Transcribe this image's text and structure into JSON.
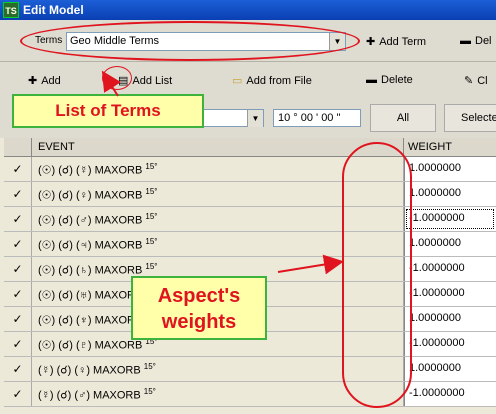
{
  "window": {
    "title": "Edit Model",
    "logo": "TS"
  },
  "toolbar1": {
    "terms_label": "Terms",
    "terms_value": "Geo Middle Terms",
    "add_term_label": "Add Term",
    "delete_label": "Del"
  },
  "toolbar2": {
    "add_label": "Add",
    "add_list_label": "Add List",
    "add_from_file_label": "Add from File",
    "delete_label": "Delete",
    "clear_label": "Cl"
  },
  "filter": {
    "time_value": "10 ° 00 ' 00 \"",
    "all_label": "All",
    "select_label": "Selecte"
  },
  "table": {
    "columns": [
      "EVENT",
      "WEIGHT"
    ],
    "rows": [
      {
        "check": "✓",
        "event": "(☉) (☌) (☿)  MAXORB",
        "orb": "15°",
        "weight": "1.0000000"
      },
      {
        "check": "✓",
        "event": "(☉) (☌) (♀)  MAXORB",
        "orb": "15°",
        "weight": "1.0000000"
      },
      {
        "check": "✓",
        "event": "(☉) (☌) (♂)  MAXORB",
        "orb": "15°",
        "weight": "-1.0000000"
      },
      {
        "check": "✓",
        "event": "(☉) (☌) (♃)  MAXORB",
        "orb": "15°",
        "weight": "1.0000000"
      },
      {
        "check": "✓",
        "event": "(☉) (☌) (♄)  MAXORB",
        "orb": "15°",
        "weight": "-1.0000000"
      },
      {
        "check": "✓",
        "event": "(☉) (☌) (♅)  MAXORB",
        "orb": "15°",
        "weight": "-1.0000000"
      },
      {
        "check": "✓",
        "event": "(☉) (☌) (♆)  MAXORB",
        "orb": "15°",
        "weight": "1.0000000"
      },
      {
        "check": "✓",
        "event": "(☉) (☌) (♇)  MAXORB",
        "orb": "15°",
        "weight": "-1.0000000"
      },
      {
        "check": "✓",
        "event": "(☿) (☌) (♀)  MAXORB",
        "orb": "15°",
        "weight": "1.0000000"
      },
      {
        "check": "✓",
        "event": "(☿) (☌) (♂)  MAXORB",
        "orb": "15°",
        "weight": "-1.0000000"
      }
    ]
  },
  "annotations": {
    "list_of_terms": "List of Terms",
    "aspects_weights_line1": "Aspect's",
    "aspects_weights_line2": "weights"
  },
  "colors": {
    "annotation_red": "#e0141e",
    "callout_fill": "#ffffaa",
    "callout_border": "#3db33d"
  }
}
